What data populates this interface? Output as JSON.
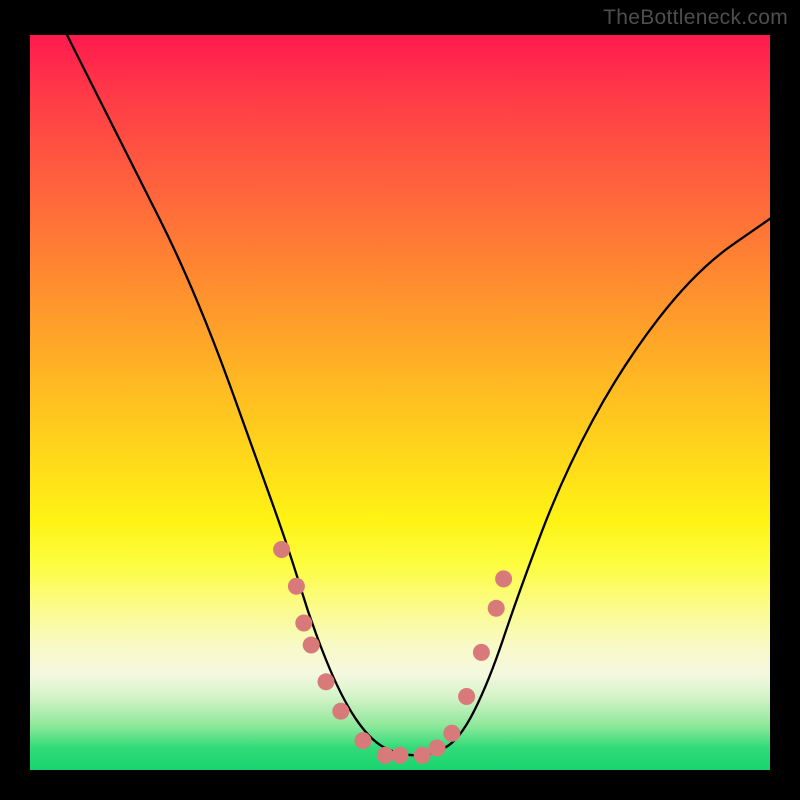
{
  "watermark": "TheBottleneck.com",
  "chart_data": {
    "type": "line",
    "title": "",
    "xlabel": "",
    "ylabel": "",
    "xlim": [
      0,
      100
    ],
    "ylim": [
      0,
      100
    ],
    "series": [
      {
        "name": "curve",
        "x": [
          5,
          10,
          15,
          20,
          25,
          30,
          35,
          38,
          42,
          46,
          50,
          54,
          58,
          62,
          66,
          72,
          80,
          90,
          100
        ],
        "y": [
          100,
          90,
          80,
          70,
          58,
          44,
          30,
          20,
          10,
          4,
          2,
          2,
          4,
          12,
          24,
          40,
          55,
          68,
          75
        ]
      }
    ],
    "dot_cluster": {
      "color": "#d97a7a",
      "points": [
        {
          "x": 34,
          "y": 30
        },
        {
          "x": 36,
          "y": 25
        },
        {
          "x": 37,
          "y": 20
        },
        {
          "x": 38,
          "y": 17
        },
        {
          "x": 40,
          "y": 12
        },
        {
          "x": 42,
          "y": 8
        },
        {
          "x": 45,
          "y": 4
        },
        {
          "x": 48,
          "y": 2
        },
        {
          "x": 50,
          "y": 2
        },
        {
          "x": 53,
          "y": 2
        },
        {
          "x": 55,
          "y": 3
        },
        {
          "x": 57,
          "y": 5
        },
        {
          "x": 59,
          "y": 10
        },
        {
          "x": 61,
          "y": 16
        },
        {
          "x": 63,
          "y": 22
        },
        {
          "x": 64,
          "y": 26
        }
      ]
    },
    "gradient_stops": [
      {
        "pos": 0,
        "color": "#ff1a4e"
      },
      {
        "pos": 50,
        "color": "#ffcc18"
      },
      {
        "pos": 80,
        "color": "#fbfbb0"
      },
      {
        "pos": 100,
        "color": "#18d46e"
      }
    ]
  }
}
